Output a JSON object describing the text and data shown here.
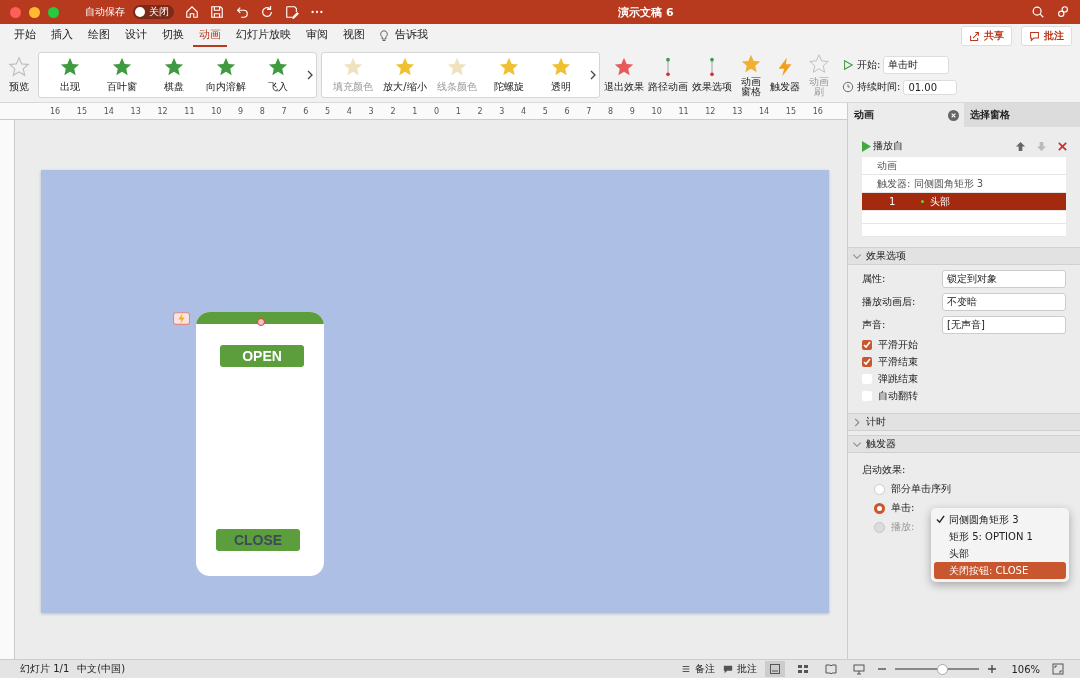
{
  "title_bar": {
    "autosave_label": "自动保存",
    "autosave_toggle": {
      "label": "关闭",
      "on": false
    },
    "title": "演示文稿 6"
  },
  "menu_tabs": [
    {
      "label": "开始",
      "selected": false
    },
    {
      "label": "插入",
      "selected": false
    },
    {
      "label": "绘图",
      "selected": false
    },
    {
      "label": "设计",
      "selected": false
    },
    {
      "label": "切换",
      "selected": false
    },
    {
      "label": "动画",
      "selected": true
    },
    {
      "label": "幻灯片放映",
      "selected": false
    },
    {
      "label": "审阅",
      "selected": false
    },
    {
      "label": "视图",
      "selected": false
    }
  ],
  "tell_me": "告诉我",
  "share_button": "共享",
  "comments_button": "批注",
  "ribbon": {
    "preview": "预览",
    "entrance_effects": [
      {
        "label": "出现",
        "disabled": false
      },
      {
        "label": "百叶窗",
        "disabled": false
      },
      {
        "label": "棋盘",
        "disabled": false
      },
      {
        "label": "向内溶解",
        "disabled": false
      },
      {
        "label": "飞入",
        "disabled": false
      }
    ],
    "emphasis_effects": [
      {
        "label": "填充颜色",
        "disabled": true
      },
      {
        "label": "放大/缩小",
        "disabled": false
      },
      {
        "label": "线条颜色",
        "disabled": true
      },
      {
        "label": "陀螺旋",
        "disabled": false
      },
      {
        "label": "透明",
        "disabled": false
      }
    ],
    "tools": [
      {
        "kind": "exit",
        "label": "退出效果",
        "disabled": false
      },
      {
        "kind": "path",
        "label": "路径动画",
        "disabled": false
      },
      {
        "kind": "options",
        "label": "效果选项",
        "disabled": false
      },
      {
        "kind": "pane",
        "label": "动画窗格",
        "disabled": false
      },
      {
        "kind": "trigger",
        "label": "触发器",
        "disabled": false
      },
      {
        "kind": "painter",
        "label": "动画刷",
        "disabled": true
      }
    ],
    "start_label": "开始:",
    "start_value": "单击时",
    "duration_label": "持续时间:",
    "duration_value": "01.00"
  },
  "ruler_numbers": [
    "16",
    "15",
    "14",
    "13",
    "12",
    "11",
    "10",
    "9",
    "8",
    "7",
    "6",
    "5",
    "4",
    "3",
    "2",
    "1",
    "0",
    "1",
    "2",
    "3",
    "4",
    "5",
    "6",
    "7",
    "8",
    "9",
    "10",
    "11",
    "12",
    "13",
    "14",
    "15",
    "16"
  ],
  "slide": {
    "open_button": "OPEN",
    "close_button": "CLOSE"
  },
  "pane": {
    "tabs": [
      {
        "label": "动画",
        "selected": true
      },
      {
        "label": "选择窗格",
        "selected": false
      }
    ],
    "play_from": "播放自",
    "list": [
      {
        "kind": "header",
        "text": "动画",
        "selected": false
      },
      {
        "kind": "header",
        "text": "触发器: 同侧圆角矩形 3",
        "selected": false
      },
      {
        "kind": "item",
        "number": "1",
        "text": "头部",
        "selected": true
      }
    ],
    "effect_options": {
      "title": "效果选项",
      "expanded": true,
      "fields": [
        {
          "label": "属性:",
          "value": "锁定到对象"
        },
        {
          "label": "播放动画后:",
          "value": "不变暗"
        },
        {
          "label": "声音:",
          "value": "[无声音]"
        }
      ],
      "checkboxes": [
        {
          "label": "平滑开始",
          "checked": true
        },
        {
          "label": "平滑结束",
          "checked": true
        },
        {
          "label": "弹跳结束",
          "checked": false
        },
        {
          "label": "自动翻转",
          "checked": false
        }
      ]
    },
    "timing": {
      "title": "计时",
      "expanded": false
    },
    "triggers": {
      "title": "触发器",
      "expanded": true,
      "start_label": "启动效果:",
      "options": [
        {
          "label": "部分单击序列",
          "selected": false,
          "disabled": false
        },
        {
          "label": "单击:",
          "selected": true,
          "disabled": false
        },
        {
          "label": "播放:",
          "selected": false,
          "disabled": true
        }
      ],
      "menu": [
        {
          "label": "同侧圆角矩形 3",
          "checked": true,
          "selected": false
        },
        {
          "label": "矩形 5: OPTION 1",
          "checked": false,
          "selected": false
        },
        {
          "label": "头部",
          "checked": false,
          "selected": false
        },
        {
          "label": "关闭按钮: CLOSE",
          "checked": false,
          "selected": true
        }
      ]
    }
  },
  "status_bar": {
    "slide": "幻灯片 1/1",
    "language": "中文(中国)",
    "notes": "备注",
    "comments": "批注",
    "zoom_slider": {
      "level": 0.55
    },
    "zoom": "106%"
  }
}
